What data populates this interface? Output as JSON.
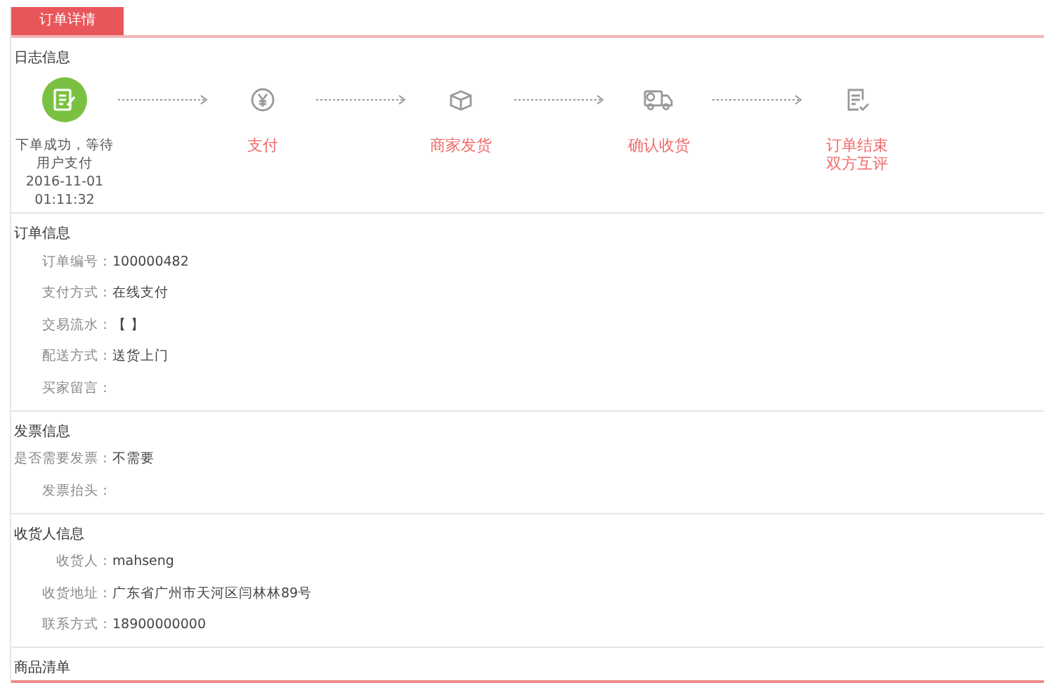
{
  "tab": {
    "label": "订单详情",
    "selected": true
  },
  "log": {
    "title": "日志信息",
    "steps": [
      {
        "kind": "edit",
        "done": true,
        "lines": [
          "下单成功，等待",
          "用户支付",
          "2016-11-01",
          "01:11:32"
        ]
      },
      {
        "kind": "pay",
        "done": false,
        "lines": [
          "支付"
        ]
      },
      {
        "kind": "ship",
        "done": false,
        "lines": [
          "商家发货"
        ]
      },
      {
        "kind": "truck",
        "done": false,
        "lines": [
          "确认收货"
        ]
      },
      {
        "kind": "review",
        "done": false,
        "lines": [
          "订单结束",
          "双方互评"
        ]
      }
    ]
  },
  "sections": [
    {
      "title": "订单信息",
      "fields": [
        {
          "label": "订单编号：",
          "value": "100000482"
        },
        {
          "label": "支付方式：",
          "value": "在线支付"
        },
        {
          "label": "交易流水：",
          "value": "【 】"
        },
        {
          "label": "配送方式：",
          "value": "送货上门"
        },
        {
          "label": "买家留言："
        }
      ]
    },
    {
      "title": "发票信息",
      "fields": [
        {
          "label": "是否需要发票：",
          "value": "不需要"
        },
        {
          "label": "发票抬头："
        }
      ]
    },
    {
      "title": "收货人信息",
      "fields": [
        {
          "label": "收货人：",
          "value": "mahseng"
        },
        {
          "label": "收货地址：",
          "value": "广东省广州市天河区闫林林89号"
        },
        {
          "label": "联系方式：",
          "value": "18900000000"
        }
      ]
    }
  ],
  "goods": {
    "title": "商品清单"
  }
}
